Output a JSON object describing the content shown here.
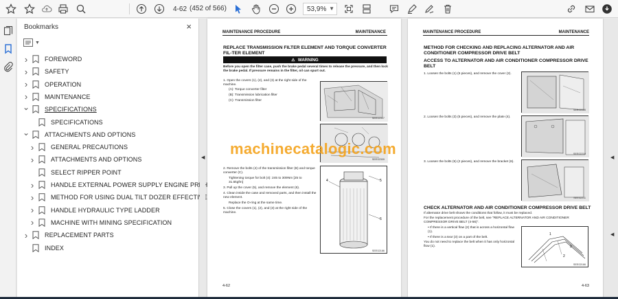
{
  "toolbar": {
    "page_input": "4-62",
    "page_count": "(452 of 566)",
    "zoom": "53,9%",
    "icons": [
      "star-icon",
      "cloud-upload-icon",
      "print-icon",
      "zoom-search-icon",
      "page-up-icon",
      "page-down-icon",
      "select-cursor-icon",
      "hand-icon",
      "zoom-out-icon",
      "zoom-in-icon",
      "zoom-dropdown-icon",
      "fit-page-icon",
      "scroll-mode-icon",
      "comment-icon",
      "highlight-icon",
      "draw-icon",
      "delete-icon",
      "share-link-icon",
      "mail-icon",
      "account-icon"
    ]
  },
  "panel": {
    "title": "Bookmarks",
    "close": "×",
    "items": [
      {
        "label": "FOREWORD",
        "level": 0,
        "expand": "right"
      },
      {
        "label": "SAFETY",
        "level": 0,
        "expand": "right"
      },
      {
        "label": "OPERATION",
        "level": 0,
        "expand": "right"
      },
      {
        "label": "MAINTENANCE",
        "level": 0,
        "expand": "right"
      },
      {
        "label": "SPECIFICATIONS",
        "level": 0,
        "expand": "down"
      },
      {
        "label": "SPECIFICATIONS",
        "level": 1,
        "expand": "none"
      },
      {
        "label": "ATTACHMENTS AND OPTIONS",
        "level": 0,
        "expand": "down"
      },
      {
        "label": "GENERAL PRECAUTIONS",
        "level": 1,
        "expand": "right"
      },
      {
        "label": "ATTACHMENTS AND OPTIONS",
        "level": 1,
        "expand": "right"
      },
      {
        "label": "SELECT RIPPER POINT",
        "level": 1,
        "expand": "none"
      },
      {
        "label": "HANDLE EXTERNAL POWER SUPPLY ENGINE PREHEATER",
        "level": 1,
        "expand": "right"
      },
      {
        "label": "METHOD FOR USING DUAL TILT DOZER EFFECTIVELY",
        "level": 1,
        "expand": "right"
      },
      {
        "label": "HANDLE HYDRAULIC TYPE LADDER",
        "level": 1,
        "expand": "right"
      },
      {
        "label": "MACHINE WITH MINING SPECIFICATION",
        "level": 1,
        "expand": "right"
      },
      {
        "label": "REPLACEMENT PARTS",
        "level": 0,
        "expand": "right"
      },
      {
        "label": "INDEX",
        "level": 0,
        "expand": "none"
      }
    ]
  },
  "left_page": {
    "header_left": "MAINTENANCE PROCEDURE",
    "header_right": "MAINTENANCE",
    "title": "REPLACE TRANSMISSION FILTER ELEMENT AND TORQUE CONVERTER FIL-TER ELEMENT",
    "warning": "WARNING",
    "warning_text": "Before you open the filter case, push the brake pedal several times to release the pressure, and then lock the brake pedal. If pressure remains in the filter, oil can spurt out.",
    "step1": "1. Open the covers (1), (2), and (3) at the right side of the machine.",
    "step1a": "(A): Torque converter filter",
    "step1b": "(B): Transmission lubrication filter",
    "step1c": "(C): Transmission filter",
    "step2": "2. Remove the bolts (4) of the transmission filter (B) and torque converter (C).",
    "step2_torque": "Tightening torque for bolt (4): 245 to 309Nm [25 to 31.5kgfm]",
    "step3": "3. Pull up the cover (5), and remove the element (6).",
    "step4": "4. Clean inside the case and removed parts, and then install the new element.",
    "step4b": "Replace the O-ring at the same time.",
    "step5": "5. Close the covers (1), (2), and (3) at the right side of the machine.",
    "fig1": "SEE02307",
    "fig2": "SEE02309",
    "fig3": "SEE02186",
    "page_number": "4-62"
  },
  "right_page": {
    "header_left": "MAINTENANCE PROCEDURE",
    "header_right": "MAINTENANCE",
    "title": "METHOD FOR CHECKING AND REPLACING ALTERNATOR AND AIR CONDITIONER COMPRESSOR DRIVE BELT",
    "subtitle": "ACCESS TO ALTERNATOR AND AIR CONDITIONER COMPRESSOR DRIVE BELT",
    "step1": "1. Loosen the bolts (1) (5 pieces), and remove the cover (2).",
    "step2": "2. Loosen the bolts (3) (5 pieces), and remove the plate (4).",
    "step3": "3. Loosen the bolts (5) (2 pieces), and remove the bracket (6).",
    "check_title": "CHECK ALTERNATOR AND AIR CONDITIONER COMPRESSOR DRIVE BELT",
    "check1": "If alternator drive belt shows the conditions that follow, it must be replaced.",
    "check2": "For the replacement procedure of the belt, see \"REPLACE ALTERNATOR AND AIR CONDITIONER COMPRESSOR DRIVE BELT (4-56)\".",
    "check3": "• If there is a vertical flow (2) that is across a horizontal flow (1).",
    "check4": "• If there is a tear (3) on a part of the belt.",
    "check5": "You do not need to replace the belt when it has only horizontal flow (1).",
    "fig1": "SEE02206",
    "fig2": "SEE02210",
    "fig3": "SEE02211",
    "fig4": "SEE02166",
    "page_number": "4-63"
  },
  "watermark": "machinecatalogic.com"
}
